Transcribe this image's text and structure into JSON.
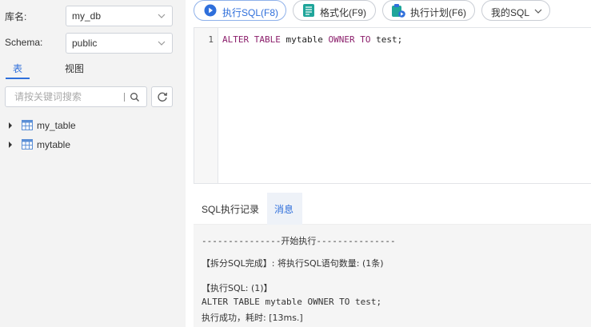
{
  "sidebar": {
    "database_label": "库名:",
    "database_value": "my_db",
    "schema_label": "Schema:",
    "schema_value": "public",
    "tabs": [
      {
        "label": "表",
        "active": true
      },
      {
        "label": "视图",
        "active": false
      }
    ],
    "search_placeholder": "请按关键词搜索",
    "tables": [
      {
        "name": "my_table"
      },
      {
        "name": "mytable"
      }
    ]
  },
  "toolbar": {
    "run_label": "执行SQL(F8)",
    "format_label": "格式化(F9)",
    "plan_label": "执行计划(F6)",
    "my_sql_label": "我的SQL"
  },
  "editor": {
    "line_number": "1",
    "tokens": {
      "kw_alter": "ALTER",
      "kw_table": "TABLE",
      "table_name": "mytable",
      "kw_owner": "OWNER",
      "kw_to": "TO",
      "rest": "test;"
    }
  },
  "result": {
    "tabs": [
      {
        "label": "SQL执行记录",
        "active": false
      },
      {
        "label": "消息",
        "active": true
      }
    ],
    "log": [
      "---------------开始执行---------------",
      "【拆分SQL完成】: 将执行SQL语句数量: (1条)",
      "【执行SQL: (1)】",
      "ALTER TABLE mytable OWNER TO test;",
      "执行成功，耗时: [13ms.]"
    ]
  },
  "colors": {
    "accent": "#2f6fdb",
    "sidebar_bg": "#f3f3f3",
    "keyword": "#8b1e6b",
    "log_bg": "#f5f5f5"
  },
  "icons": [
    "chevron-down-icon",
    "search-icon",
    "refresh-icon",
    "caret-right-icon",
    "table-icon",
    "play-icon",
    "format-icon",
    "plan-icon"
  ]
}
